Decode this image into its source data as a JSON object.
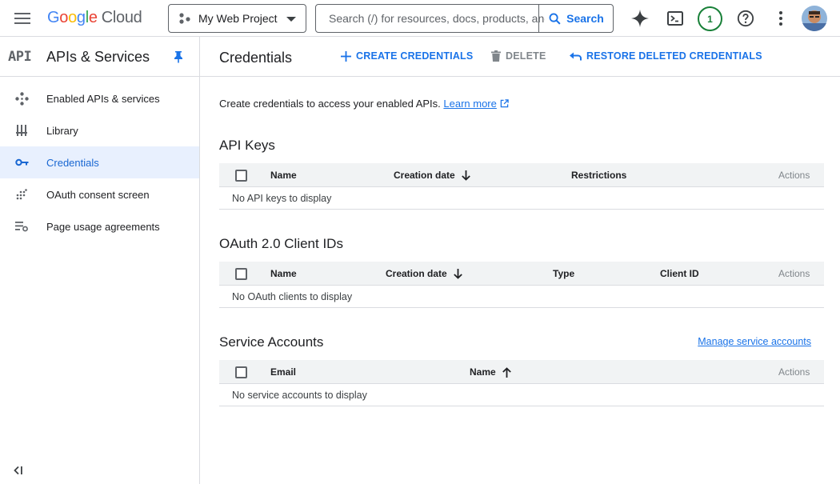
{
  "topbar": {
    "logo_letters": [
      "G",
      "o",
      "o",
      "g",
      "l",
      "e"
    ],
    "logo_suffix": "Cloud",
    "project_name": "My Web Project",
    "search_placeholder": "Search (/) for resources, docs, products, and more",
    "search_button_label": "Search",
    "notification_count": "1"
  },
  "sidebar": {
    "api_mark": "API",
    "title": "APIs & Services",
    "items": [
      {
        "label": "Enabled APIs & services",
        "icon": "diamond-nodes-icon"
      },
      {
        "label": "Library",
        "icon": "library-icon"
      },
      {
        "label": "Credentials",
        "icon": "key-icon",
        "active": true
      },
      {
        "label": "OAuth consent screen",
        "icon": "dotted-grid-icon"
      },
      {
        "label": "Page usage agreements",
        "icon": "list-settings-icon"
      }
    ],
    "collapse_label": "<|"
  },
  "main": {
    "title": "Credentials",
    "actions": {
      "create": "CREATE CREDENTIALS",
      "delete": "DELETE",
      "restore": "RESTORE DELETED CREDENTIALS"
    },
    "intro_text": "Create credentials to access your enabled APIs.",
    "learn_more": "Learn more",
    "api_keys": {
      "title": "API Keys",
      "columns": [
        "Name",
        "Creation date",
        "Restrictions",
        "Actions"
      ],
      "empty": "No API keys to display"
    },
    "oauth": {
      "title": "OAuth 2.0 Client IDs",
      "columns": [
        "Name",
        "Creation date",
        "Type",
        "Client ID",
        "Actions"
      ],
      "empty": "No OAuth clients to display"
    },
    "service_accounts": {
      "title": "Service Accounts",
      "manage_link": "Manage service accounts",
      "columns": [
        "Email",
        "Name",
        "Actions"
      ],
      "empty": "No service accounts to display"
    }
  },
  "colors": {
    "accent": "#1a73e8",
    "active_bg": "#e8f0fe",
    "badge_green": "#188038"
  }
}
